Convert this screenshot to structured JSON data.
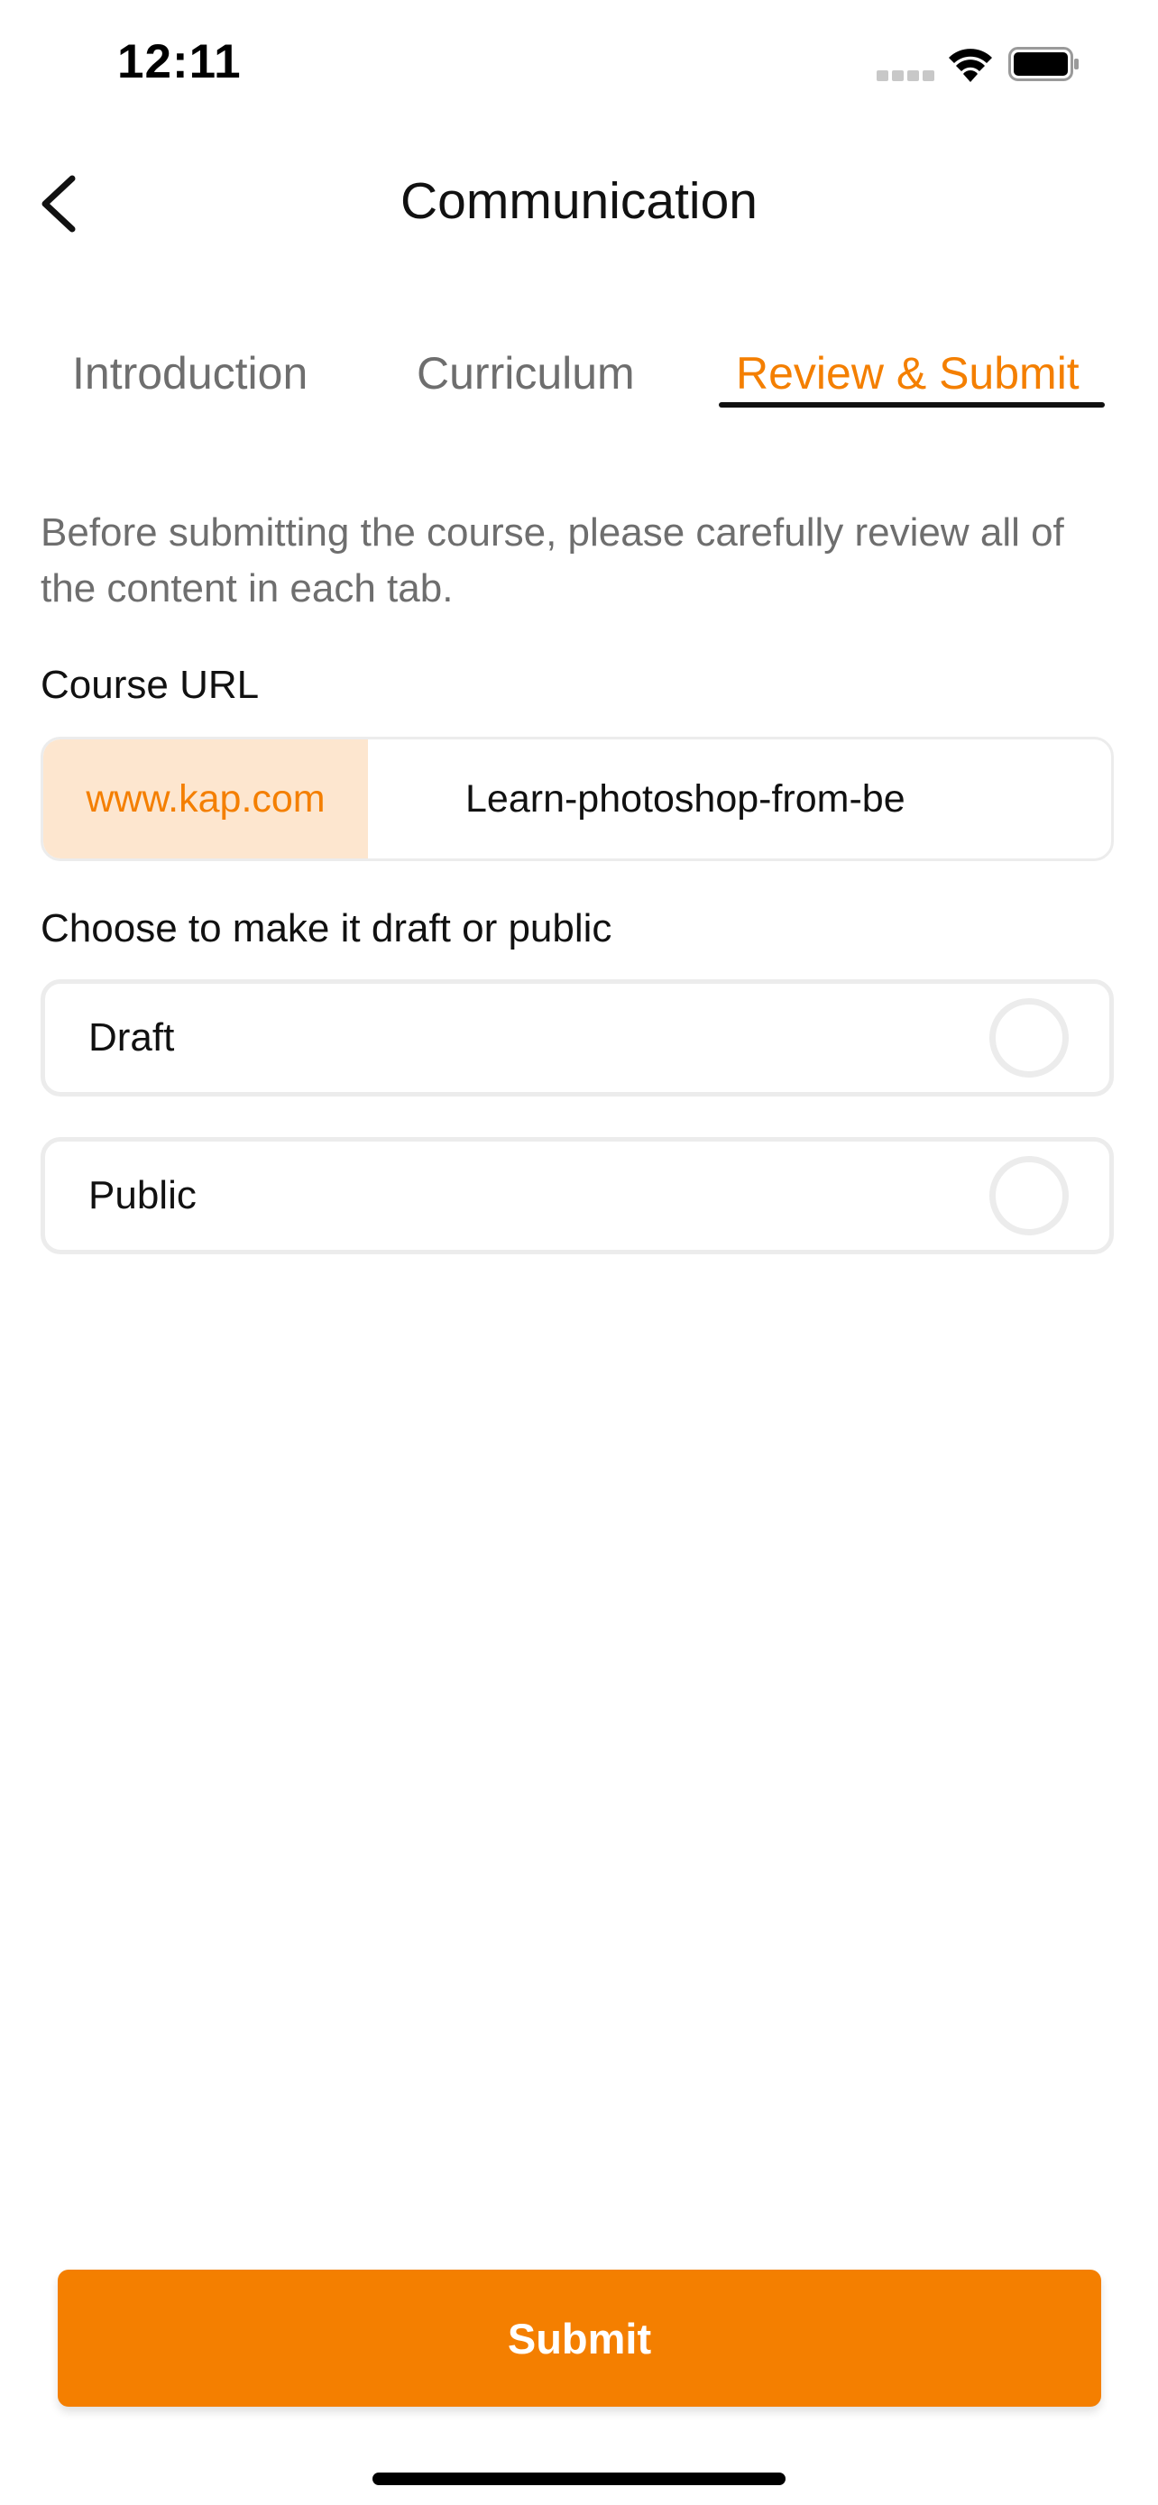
{
  "status_bar": {
    "time": "12:11"
  },
  "header": {
    "title": "Communication",
    "back_icon": "chevron-left-icon"
  },
  "tabs": [
    {
      "label": "Introduction",
      "active": false
    },
    {
      "label": "Curriculum",
      "active": false
    },
    {
      "label": "Review & Submit",
      "active": true
    }
  ],
  "description": "Before submitting the course, please carefully review all of the content in each tab.",
  "course_url": {
    "label": "Course URL",
    "prefix": "www.kap.com",
    "slug": "Learn-photoshop-from-be"
  },
  "visibility": {
    "label": "Choose to make it draft or public",
    "options": [
      {
        "label": "Draft",
        "selected": false
      },
      {
        "label": "Public",
        "selected": false
      }
    ]
  },
  "submit_label": "Submit",
  "colors": {
    "accent": "#f47f00",
    "prefix_bg": "#fde6cf",
    "border": "#ececec",
    "muted_text": "#6e6e6e"
  }
}
